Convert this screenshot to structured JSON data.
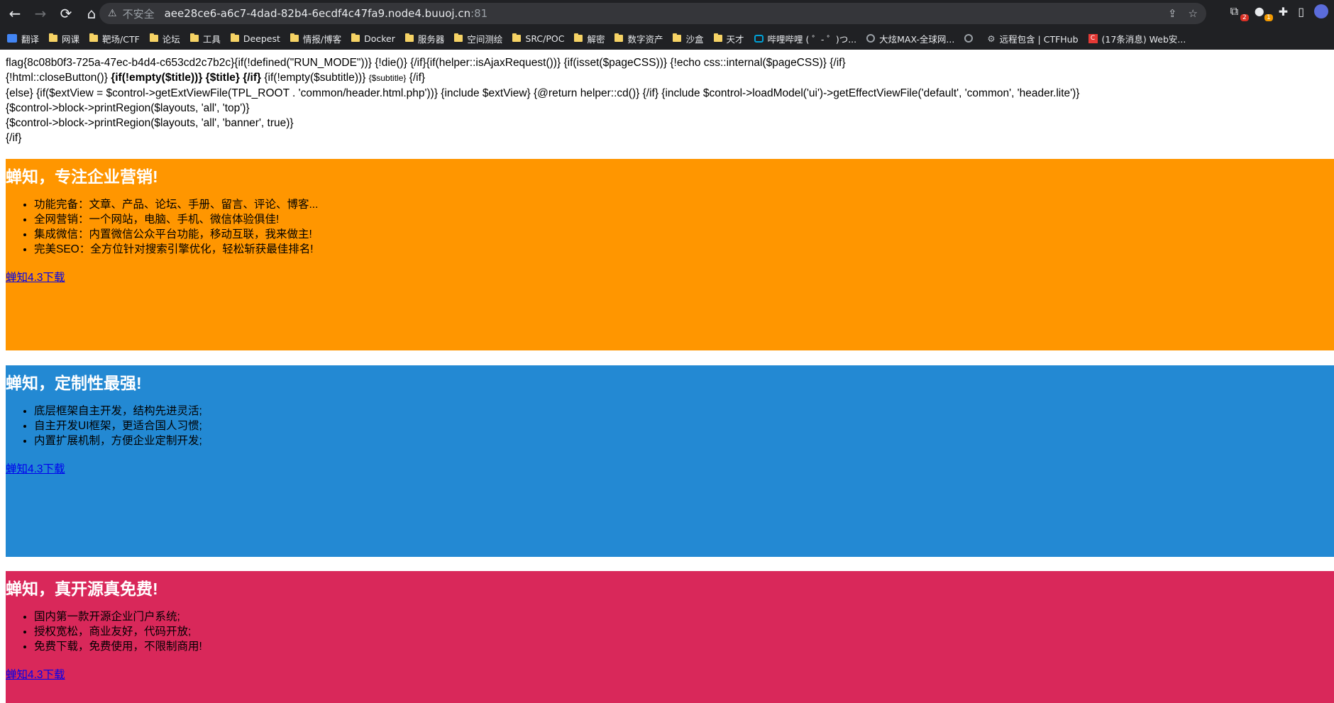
{
  "browser": {
    "address": {
      "insecure_label": "不安全",
      "host": "aee28ce6-a6c7-4dad-82b4-6ecdf4c47fa9.node4.buuoj.cn",
      "port": ":81"
    },
    "extension_badges": [
      "2",
      "1"
    ],
    "bookmarks": [
      {
        "icon": "translate-icon",
        "label": "翻译"
      },
      {
        "icon": "folder-icon",
        "label": "网课"
      },
      {
        "icon": "folder-icon",
        "label": "靶场/CTF"
      },
      {
        "icon": "folder-icon",
        "label": "论坛"
      },
      {
        "icon": "folder-icon",
        "label": "工具"
      },
      {
        "icon": "folder-icon",
        "label": "Deepest"
      },
      {
        "icon": "folder-icon",
        "label": "情报/博客"
      },
      {
        "icon": "folder-icon",
        "label": "Docker"
      },
      {
        "icon": "folder-icon",
        "label": "服务器"
      },
      {
        "icon": "folder-icon",
        "label": "空间测绘"
      },
      {
        "icon": "folder-icon",
        "label": "SRC/POC"
      },
      {
        "icon": "folder-icon",
        "label": "解密"
      },
      {
        "icon": "folder-icon",
        "label": "数字资产"
      },
      {
        "icon": "folder-icon",
        "label": "沙盒"
      },
      {
        "icon": "folder-icon",
        "label": "天才"
      },
      {
        "icon": "bilibili-icon",
        "label": "哔哩哔哩 ( ゜- ゜)つ..."
      },
      {
        "icon": "globe-icon",
        "label": "大炫MAX-全球网..."
      },
      {
        "icon": "globe-icon",
        "label": ""
      },
      {
        "icon": "gear-icon",
        "label": "远程包含 | CTFHub"
      },
      {
        "icon": "csdn-icon",
        "label": "(17条消息) Web安..."
      }
    ]
  },
  "page": {
    "code_lines": {
      "line1": "flag{8c08b0f3-725a-47ec-b4d4-c653cd2c7b2c}{if(!defined(\"RUN_MODE\"))} {!die()} {/if}{if(helper::isAjaxRequest())} {if(isset($pageCSS))} {!echo css::internal($pageCSS)} {/if}",
      "line2_a": "{!html::closeButton()} ",
      "line2_b": "{if(!empty($title))} {$title} {/if}",
      "line2_c": " {if(!empty($subtitle))} ",
      "line2_d": "{$subtitle}",
      "line2_e": " {/if}",
      "line3": "{else} {if($extView = $control->getExtViewFile(TPL_ROOT . 'common/header.html.php'))} {include $extView} {@return helper::cd()} {/if} {include $control->loadModel('ui')->getEffectViewFile('default', 'common', 'header.lite')}",
      "line4": "{$control->block->printRegion($layouts, 'all', 'top')}",
      "line5": "{$control->block->printRegion($layouts, 'all', 'banner', true)}",
      "line6": "{/if}"
    },
    "banners": [
      {
        "title": "蝉知，专注企业营销!",
        "items": [
          "功能完备：文章、产品、论坛、手册、留言、评论、博客...",
          "全网营销：一个网站，电脑、手机、微信体验俱佳!",
          "集成微信：内置微信公众平台功能，移动互联，我来做主!",
          "完美SEO：全方位针对搜索引擎优化，轻松斩获最佳排名!"
        ],
        "link": "蝉知4.3下载",
        "color": "#ff9600"
      },
      {
        "title": "蝉知，定制性最强!",
        "items": [
          "底层框架自主开发，结构先进灵活;",
          "自主开发UI框架，更适合国人习惯;",
          "内置扩展机制，方便企业定制开发;"
        ],
        "link": "蝉知4.3下载",
        "color": "#2389d3"
      },
      {
        "title": "蝉知，真开源真免费!",
        "items": [
          "国内第一款开源企业门户系统;",
          "授权宽松，商业友好，代码开放;",
          "免费下载，免费使用，不限制商用!"
        ],
        "link": "蝉知4.3下载",
        "color": "#d9285a"
      }
    ]
  }
}
